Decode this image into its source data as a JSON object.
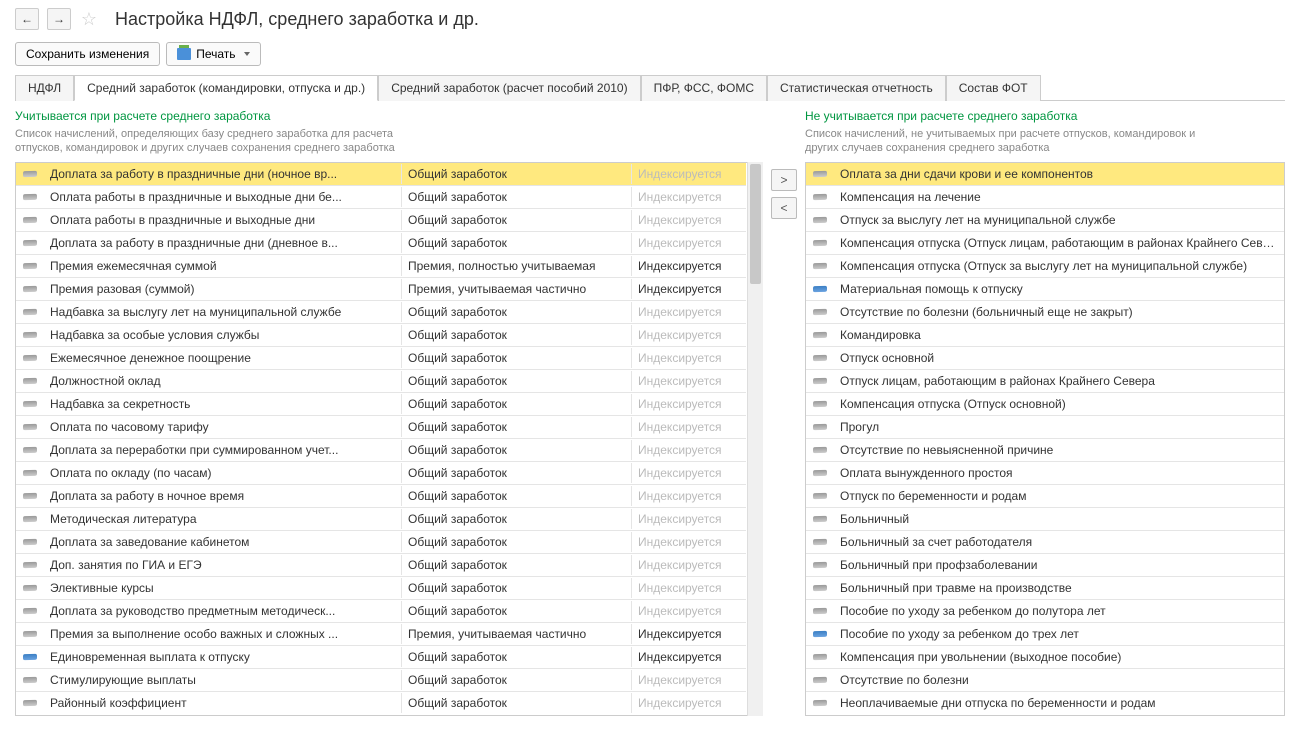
{
  "header": {
    "title": "Настройка НДФЛ, среднего заработка и др."
  },
  "toolbar": {
    "save": "Сохранить изменения",
    "print": "Печать"
  },
  "tabs": [
    "НДФЛ",
    "Средний заработок (командировки, отпуска и др.)",
    "Средний заработок (расчет пособий 2010)",
    "ПФР, ФСС, ФОМС",
    "Статистическая отчетность",
    "Состав ФОТ"
  ],
  "left": {
    "title": "Учитывается при расчете среднего заработка",
    "desc": "Список начислений, определяющих базу среднего заработка для расчета отпусков, командировок и других случаев сохранения среднего заработка",
    "rows": [
      {
        "name": "Доплата за работу в праздничные дни (ночное вр...",
        "type": "Общий заработок",
        "idx": "Индексируется",
        "grey": true,
        "sel": true
      },
      {
        "name": "Оплата работы в праздничные и выходные дни бе...",
        "type": "Общий заработок",
        "idx": "Индексируется",
        "grey": true
      },
      {
        "name": "Оплата работы в праздничные и выходные дни",
        "type": "Общий заработок",
        "idx": "Индексируется",
        "grey": true
      },
      {
        "name": "Доплата за работу в праздничные дни (дневное в...",
        "type": "Общий заработок",
        "idx": "Индексируется",
        "grey": true
      },
      {
        "name": "Премия ежемесячная суммой",
        "type": "Премия, полностью учитываемая",
        "idx": "Индексируется"
      },
      {
        "name": "Премия разовая (суммой)",
        "type": "Премия, учитываемая частично",
        "idx": "Индексируется"
      },
      {
        "name": "Надбавка за выслугу лет на муниципальной службе",
        "type": "Общий заработок",
        "idx": "Индексируется",
        "grey": true
      },
      {
        "name": "Надбавка за особые условия службы",
        "type": "Общий заработок",
        "idx": "Индексируется",
        "grey": true
      },
      {
        "name": "Ежемесячное денежное поощрение",
        "type": "Общий заработок",
        "idx": "Индексируется",
        "grey": true
      },
      {
        "name": "Должностной оклад",
        "type": "Общий заработок",
        "idx": "Индексируется",
        "grey": true
      },
      {
        "name": "Надбавка за секретность",
        "type": "Общий заработок",
        "idx": "Индексируется",
        "grey": true
      },
      {
        "name": "Оплата по часовому тарифу",
        "type": "Общий заработок",
        "idx": "Индексируется",
        "grey": true
      },
      {
        "name": "Доплата за переработки при суммированном учет...",
        "type": "Общий заработок",
        "idx": "Индексируется",
        "grey": true
      },
      {
        "name": "Оплата по окладу (по часам)",
        "type": "Общий заработок",
        "idx": "Индексируется",
        "grey": true
      },
      {
        "name": "Доплата за работу в ночное время",
        "type": "Общий заработок",
        "idx": "Индексируется",
        "grey": true
      },
      {
        "name": "Методическая литература",
        "type": "Общий заработок",
        "idx": "Индексируется",
        "grey": true
      },
      {
        "name": "Доплата за заведование кабинетом",
        "type": "Общий заработок",
        "idx": "Индексируется",
        "grey": true
      },
      {
        "name": "Доп. занятия по ГИА и ЕГЭ",
        "type": "Общий заработок",
        "idx": "Индексируется",
        "grey": true
      },
      {
        "name": "Элективные курсы",
        "type": "Общий заработок",
        "idx": "Индексируется",
        "grey": true
      },
      {
        "name": "Доплата за руководство предметным методическ...",
        "type": "Общий заработок",
        "idx": "Индексируется",
        "grey": true
      },
      {
        "name": "Премия за выполнение особо важных и сложных ...",
        "type": "Премия, учитываемая частично",
        "idx": "Индексируется"
      },
      {
        "name": "Единовременная выплата к отпуску",
        "type": "Общий заработок",
        "idx": "Индексируется",
        "blue": true
      },
      {
        "name": "Стимулирующие выплаты",
        "type": "Общий заработок",
        "idx": "Индексируется",
        "grey": true
      },
      {
        "name": "Районный коэффициент",
        "type": "Общий заработок",
        "idx": "Индексируется",
        "grey": true
      }
    ]
  },
  "right": {
    "title": "Не учитывается при расчете среднего заработка",
    "desc": "Список начислений, не учитываемых при расчете отпусков, командировок и других случаев сохранения среднего заработка",
    "rows": [
      {
        "name": "Оплата за дни сдачи крови и ее компонентов",
        "sel": true
      },
      {
        "name": "Компенсация на лечение"
      },
      {
        "name": "Отпуск за выслугу лет на муниципальной службе"
      },
      {
        "name": "Компенсация отпуска (Отпуск лицам, работающим в районах Крайнего Севера)"
      },
      {
        "name": "Компенсация отпуска (Отпуск за выслугу лет на муниципальной службе)"
      },
      {
        "name": "Материальная помощь к отпуску",
        "blue": true
      },
      {
        "name": "Отсутствие по болезни (больничный еще не закрыт)"
      },
      {
        "name": "Командировка"
      },
      {
        "name": "Отпуск основной"
      },
      {
        "name": "Отпуск лицам, работающим в районах Крайнего Севера"
      },
      {
        "name": "Компенсация отпуска (Отпуск основной)"
      },
      {
        "name": "Прогул"
      },
      {
        "name": "Отсутствие по невыясненной причине"
      },
      {
        "name": "Оплата вынужденного простоя"
      },
      {
        "name": "Отпуск по беременности и родам"
      },
      {
        "name": "Больничный"
      },
      {
        "name": "Больничный за счет работодателя"
      },
      {
        "name": "Больничный при профзаболевании"
      },
      {
        "name": "Больничный при травме на производстве"
      },
      {
        "name": "Пособие по уходу за ребенком до полутора лет"
      },
      {
        "name": "Пособие по уходу за ребенком до трех лет",
        "blue": true
      },
      {
        "name": "Компенсация при увольнении (выходное пособие)"
      },
      {
        "name": "Отсутствие по болезни"
      },
      {
        "name": "Неоплачиваемые дни отпуска по беременности и родам"
      }
    ]
  },
  "move": {
    "right": ">",
    "left": "<"
  }
}
